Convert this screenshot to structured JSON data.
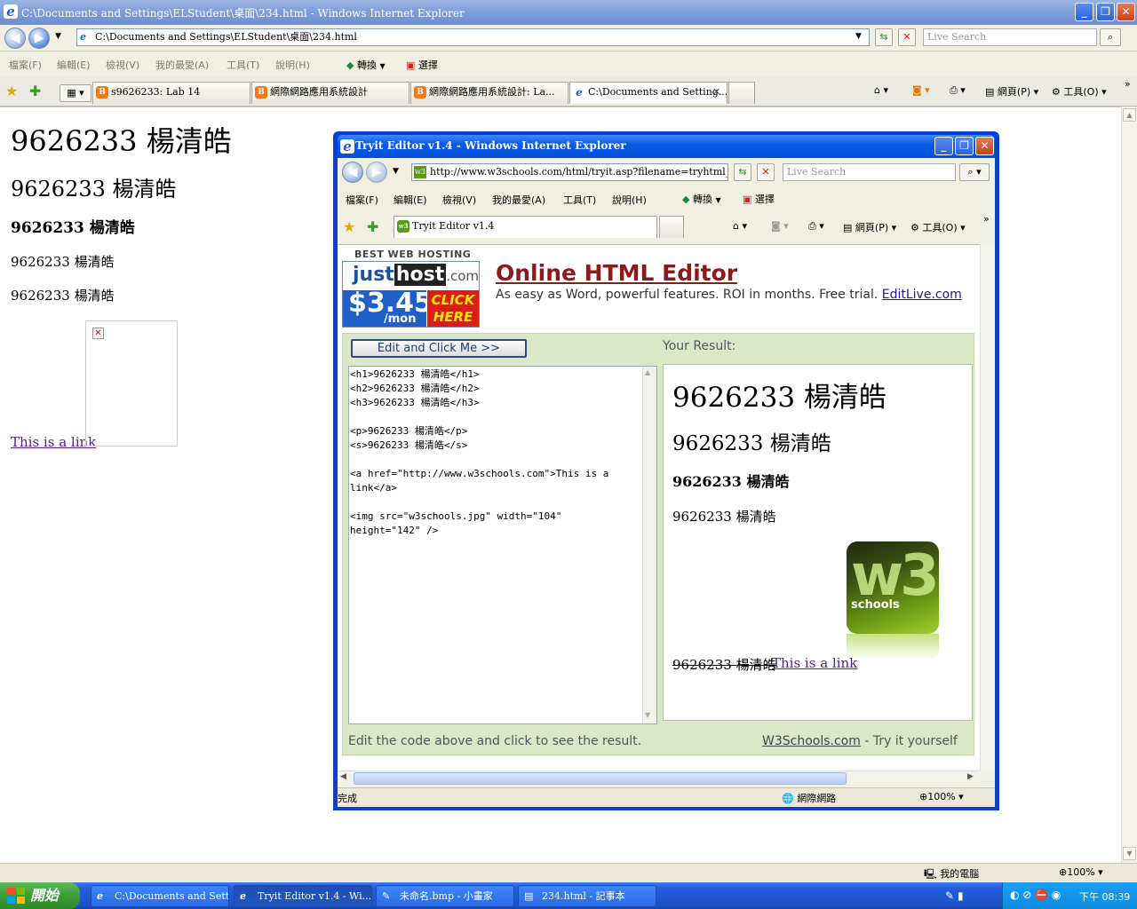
{
  "window": {
    "title": "C:\\Documents and Settings\\ELStudent\\桌面\\234.html - Windows Internet Explorer",
    "address": "C:\\Documents and Settings\\ELStudent\\桌面\\234.html",
    "search_placeholder": "Live Search"
  },
  "menu": [
    "檔案(F)",
    "編輯(E)",
    "檢視(V)",
    "我的最愛(A)",
    "工具(T)",
    "說明(H)"
  ],
  "menu_extra": {
    "convert": "轉換",
    "select": "選擇"
  },
  "tabs": [
    {
      "label": "s9626233: Lab 14"
    },
    {
      "label": "網際網路應用系統設計"
    },
    {
      "label": "網際網路應用系統設計: La..."
    },
    {
      "label": "C:\\Documents and Setting..."
    }
  ],
  "toolbar_right": {
    "page": "網頁(P)",
    "tools": "工具(O)"
  },
  "page": {
    "h1": "9626233 楊清皓",
    "h2": "9626233 楊清皓",
    "h3": "9626233 楊清皓",
    "p": "9626233 楊清皓",
    "s": "9626233 楊清皓",
    "link": "This is a link"
  },
  "status": {
    "zone": "我的電腦",
    "zoom": "100%"
  },
  "popup": {
    "title": "Tryit Editor v1.4 - Windows Internet Explorer",
    "address": "http://www.w3schools.com/html/tryit.asp?filename=tryhtml_basic",
    "search_placeholder": "Live Search",
    "menu": [
      "檔案(F)",
      "編輯(E)",
      "檢視(V)",
      "我的最愛(A)",
      "工具(T)",
      "說明(H)"
    ],
    "menu_extra": {
      "convert": "轉換",
      "select": "選擇"
    },
    "tab": "Tryit Editor v1.4",
    "toolbar_right": {
      "page": "網頁(P)",
      "tools": "工具(O)"
    },
    "ad": {
      "best": "BEST WEB HOSTING",
      "logo_a": "just",
      "logo_b": "host",
      "logo_c": ".com",
      "price": "$3.45",
      "per": "/mon",
      "click": "CLICK HERE",
      "title": "Online HTML Editor",
      "sub": "As easy as Word, powerful features. ROI in months. Free trial.",
      "sub_link": "EditLive.com"
    },
    "edit_button": "Edit and Click Me >>",
    "your_result": "Your Result:",
    "code": "<h1>9626233 楊清皓</h1>\n<h2>9626233 楊清皓</h2>\n<h3>9626233 楊清皓</h3>\n\n<p>9626233 楊清皓</p>\n<s>9626233 楊清皓</s>\n\n<a href=\"http://www.w3schools.com\">This is a\nlink</a>\n\n<img src=\"w3schools.jpg\" width=\"104\"\nheight=\"142\" />",
    "result": {
      "h1": "9626233 楊清皓",
      "h2": "9626233 楊清皓",
      "h3": "9626233 楊清皓",
      "p": "9626233 楊清皓",
      "s": "9626233 楊清皓",
      "link": "This is a link",
      "logo_text": "schools"
    },
    "footer_left": "Edit the code above and click to see the result.",
    "footer_link": "W3Schools.com",
    "footer_right": " - Try it yourself",
    "status_left": "完成",
    "status_zone": "網際網路",
    "status_zoom": "100%"
  },
  "taskbar": {
    "start": "開始",
    "items": [
      "C:\\Documents and Sett...",
      "Tryit Editor v1.4 - Wi...",
      "未命名.bmp - 小畫家",
      "234.html - 記事本"
    ],
    "clock": "下午 08:39"
  }
}
